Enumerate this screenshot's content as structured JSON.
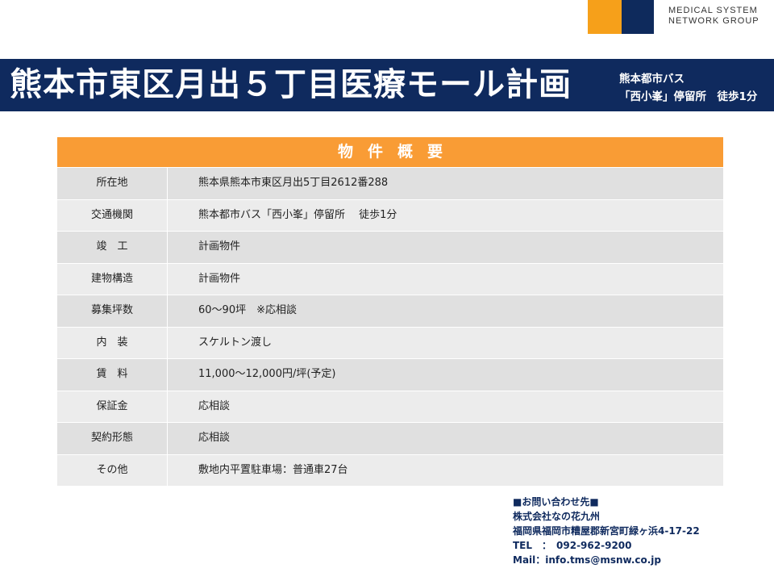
{
  "logo": {
    "line1": "MEDICAL SYSTEM",
    "line2": "NETWORK GROUP",
    "colors": {
      "orange": "#f6a01a",
      "navy": "#0e2a5c"
    }
  },
  "header": {
    "title": "熊本市東区月出５丁目医療モール計画",
    "access_line1": "熊本都市バス",
    "access_line2": "「西小峯」停留所　徒歩1分",
    "band_color": "#0f2a5e"
  },
  "overview": {
    "heading": "物件概要",
    "heading_color": "#f99c35",
    "rows": [
      {
        "label": "所在地",
        "value": "熊本県熊本市東区月出5丁目2612番288"
      },
      {
        "label": "交通機関",
        "value": "熊本都市バス「西小峯」停留所　 徒歩1分"
      },
      {
        "label": "竣　工",
        "value": "計画物件"
      },
      {
        "label": "建物構造",
        "value": "計画物件"
      },
      {
        "label": "募集坪数",
        "value": "60～90坪　※応相談"
      },
      {
        "label": "内　装",
        "value": "スケルトン渡し"
      },
      {
        "label": "賃　料",
        "value": "11,000～12,000円/坪(予定)"
      },
      {
        "label": "保証金",
        "value": "応相談"
      },
      {
        "label": "契約形態",
        "value": "応相談"
      },
      {
        "label": "その他",
        "value": "敷地内平置駐車場：普通車27台"
      }
    ]
  },
  "contact": {
    "heading": "■お問い合わせ先■",
    "company": "株式会社なの花九州",
    "address": "福岡県福岡市糟屋郡新宮町緑ヶ浜4-17-22",
    "tel": "TEL　：　092-962-9200",
    "mail": "Mail：info.tms@msnw.co.jp"
  }
}
